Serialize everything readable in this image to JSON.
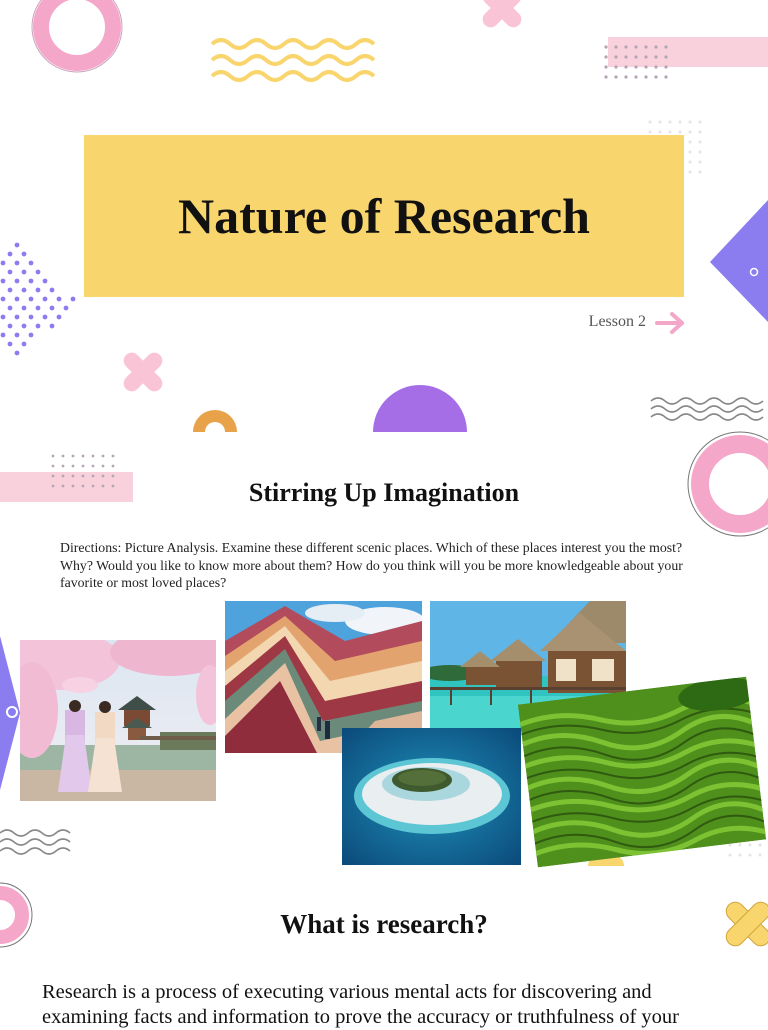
{
  "title": {
    "text": "Nature of Research",
    "lesson_label": "Lesson 2",
    "banner_color": "#f9d56e"
  },
  "section1": {
    "heading": "Stirring Up Imagination",
    "directions": "Directions: Picture Analysis. Examine these different scenic places. Which of these places interest you the most? Why? Would you like to know more about them? How do you think will you be more knowledgeable about your favorite or most loved places?"
  },
  "photos": [
    {
      "name": "cherry-blossom-palace-photo"
    },
    {
      "name": "rainbow-mountain-photo"
    },
    {
      "name": "overwater-bungalows-photo"
    },
    {
      "name": "atoll-island-photo"
    },
    {
      "name": "rice-terraces-photo"
    }
  ],
  "section2": {
    "heading": "What is research?",
    "body": "Research is a process of executing various mental acts for discovering and examining facts and information to prove the accuracy or truthfulness of your"
  },
  "colors": {
    "accent_pink": "#f4a7c8",
    "accent_light_pink": "#f9d1dc",
    "accent_purple": "#8b7cf0",
    "accent_violet": "#a56ee6",
    "accent_yellow": "#f9d56e",
    "accent_orange": "#e8a24a"
  }
}
